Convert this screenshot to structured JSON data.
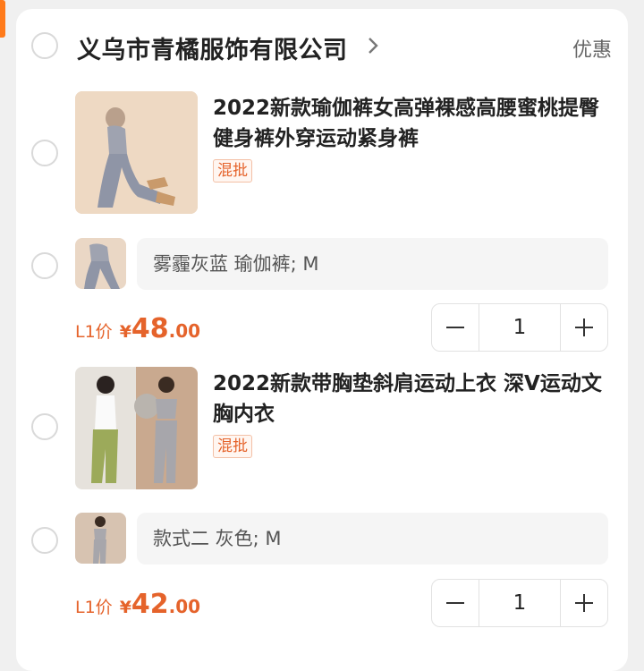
{
  "shop": {
    "name": "义乌市青橘服饰有限公司",
    "discount_label": "优惠"
  },
  "items": [
    {
      "title": "2022新款瑜伽裤女高弹裸感高腰蜜桃提臀健身裤外穿运动紧身裤",
      "tag": "混批",
      "spec": "雾霾灰蓝  瑜伽裤; M",
      "price_prefix": "L1价",
      "price_symbol": "¥",
      "price_int": "48",
      "price_dec": ".00",
      "quantity": "1"
    },
    {
      "title": "2022新款带胸垫斜肩运动上衣 深V运动文胸内衣",
      "tag": "混批",
      "spec": "款式二 灰色; M",
      "price_prefix": "L1价",
      "price_symbol": "¥",
      "price_int": "42",
      "price_dec": ".00",
      "quantity": "1"
    }
  ],
  "colors": {
    "accent": "#e5632b",
    "background": "#f0f0f0"
  }
}
